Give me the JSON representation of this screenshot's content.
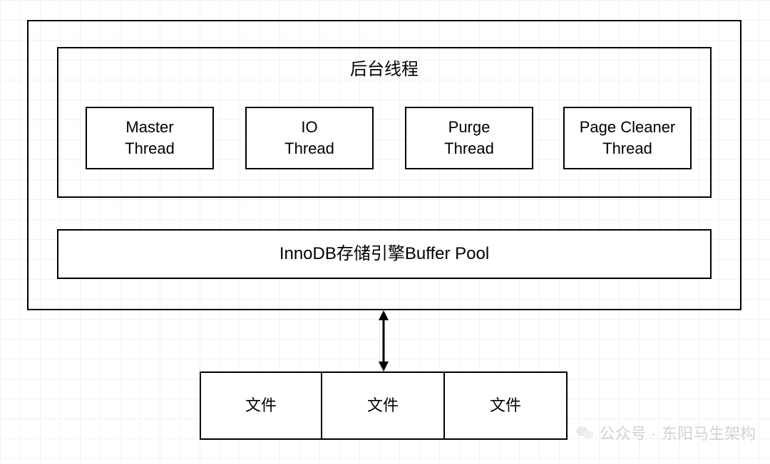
{
  "diagram": {
    "threads_title": "后台线程",
    "threads": [
      {
        "line1": "Master",
        "line2": "Thread"
      },
      {
        "line1": "IO",
        "line2": "Thread"
      },
      {
        "line1": "Purge",
        "line2": "Thread"
      },
      {
        "line1": "Page Cleaner",
        "line2": "Thread"
      }
    ],
    "buffer_pool": "InnoDB存储引擎Buffer Pool",
    "files": [
      "文件",
      "文件",
      "文件"
    ]
  },
  "watermark": {
    "prefix": "公众号 ·",
    "name": "东阳马生架构"
  }
}
